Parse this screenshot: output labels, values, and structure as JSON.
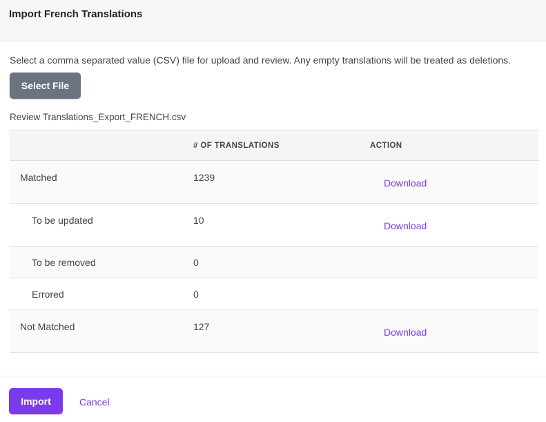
{
  "dialog": {
    "title": "Import French Translations",
    "description": "Select a comma separated value (CSV) file for upload and review. Any empty translations will be treated as deletions.",
    "select_file_label": "Select File",
    "review_label": "Review Translations_Export_FRENCH.csv"
  },
  "table": {
    "headers": {
      "category": "",
      "count": "# OF TRANSLATIONS",
      "action": "ACTION"
    },
    "rows": [
      {
        "category": "Matched",
        "count": "1239",
        "action": "Download"
      },
      {
        "category": "To be updated",
        "count": "10",
        "action": "Download"
      },
      {
        "category": "To be removed",
        "count": "0",
        "action": ""
      },
      {
        "category": "Errored",
        "count": "0",
        "action": ""
      },
      {
        "category": "Not Matched",
        "count": "127",
        "action": "Download"
      }
    ]
  },
  "footer": {
    "import_label": "Import",
    "cancel_label": "Cancel"
  },
  "colors": {
    "accent": "#7c3aed",
    "secondary_button": "#6b7280",
    "header_bg": "#f7f7f7"
  }
}
